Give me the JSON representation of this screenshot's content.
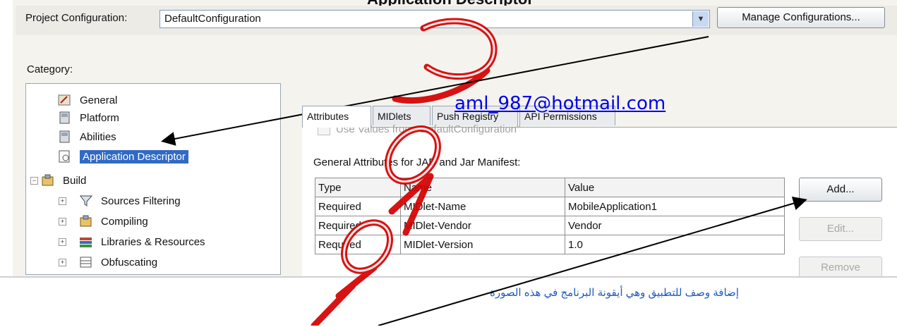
{
  "header_fragment": "Application Descriptor",
  "project_config": {
    "label": "Project Configuration:",
    "value": "DefaultConfiguration",
    "manage_button": "Manage Configurations..."
  },
  "category": {
    "label": "Category:",
    "items": [
      {
        "label": "General"
      },
      {
        "label": "Platform"
      },
      {
        "label": "Abilities"
      },
      {
        "label": "Application Descriptor",
        "selected": true
      },
      {
        "label": "Build"
      },
      {
        "label": "Sources Filtering"
      },
      {
        "label": "Compiling"
      },
      {
        "label": "Libraries & Resources"
      },
      {
        "label": "Obfuscating"
      }
    ]
  },
  "tabs": [
    "Attributes",
    "MIDlets",
    "Push Registry",
    "API Permissions"
  ],
  "use_values_label": "Use Values from \"DefaultConfiguration\"",
  "attributes_title": "General Attributes for JAD and Jar Manifest:",
  "table": {
    "columns": [
      "Type",
      "Name",
      "Value"
    ],
    "rows": [
      [
        "Required",
        "MIDlet-Name",
        "MobileApplication1"
      ],
      [
        "Required",
        "MIDlet-Vendor",
        "Vendor"
      ],
      [
        "Required",
        "MIDlet-Version",
        "1.0"
      ]
    ]
  },
  "buttons": {
    "add": "Add...",
    "edit": "Edit...",
    "remove": "Remove"
  },
  "email": "aml_987@hotmail.com",
  "note": "إضافة وصف للتطبيق وهي أيقونة البرنامج في هذه الصورة",
  "colors": {
    "selection": "#316ac5",
    "watermark": "#d40000",
    "note": "#1e5bbd"
  }
}
